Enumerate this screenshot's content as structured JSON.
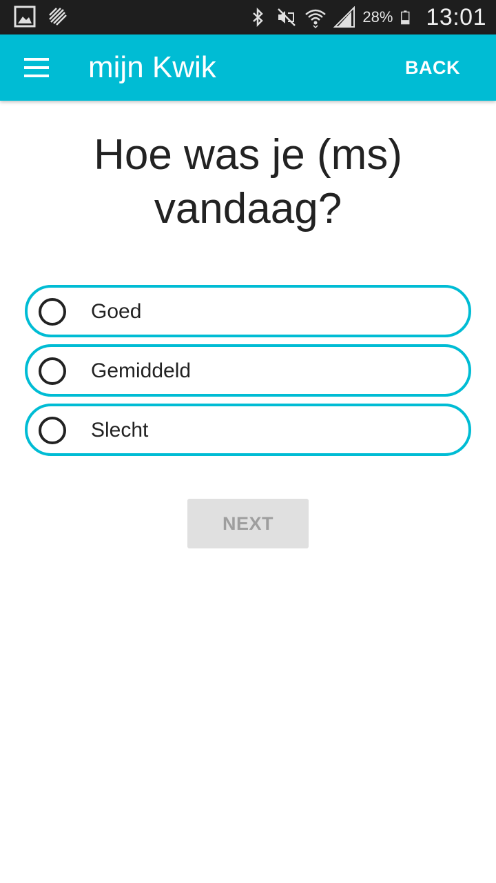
{
  "status_bar": {
    "battery": "28%",
    "time": "13:01",
    "icons": [
      "gallery-icon",
      "health-icon",
      "bluetooth-icon",
      "nfc-icon",
      "mute-icon",
      "wifi-icon",
      "signal-icon",
      "battery-icon"
    ]
  },
  "app_bar": {
    "title": "mijn Kwik",
    "back_label": "BACK",
    "menu_icon": "hamburger-menu-icon",
    "background_color": "#00bcd4"
  },
  "question": {
    "text": "Hoe was je (ms) vandaag?"
  },
  "options": [
    {
      "label": "Goed",
      "selected": false
    },
    {
      "label": "Gemiddeld",
      "selected": false
    },
    {
      "label": "Slecht",
      "selected": false
    }
  ],
  "next_button": {
    "label": "NEXT",
    "enabled": false
  },
  "colors": {
    "accent": "#00bcd4",
    "text": "#222222",
    "disabled_button_bg": "#e0e0e0",
    "disabled_button_text": "#9e9e9e"
  }
}
